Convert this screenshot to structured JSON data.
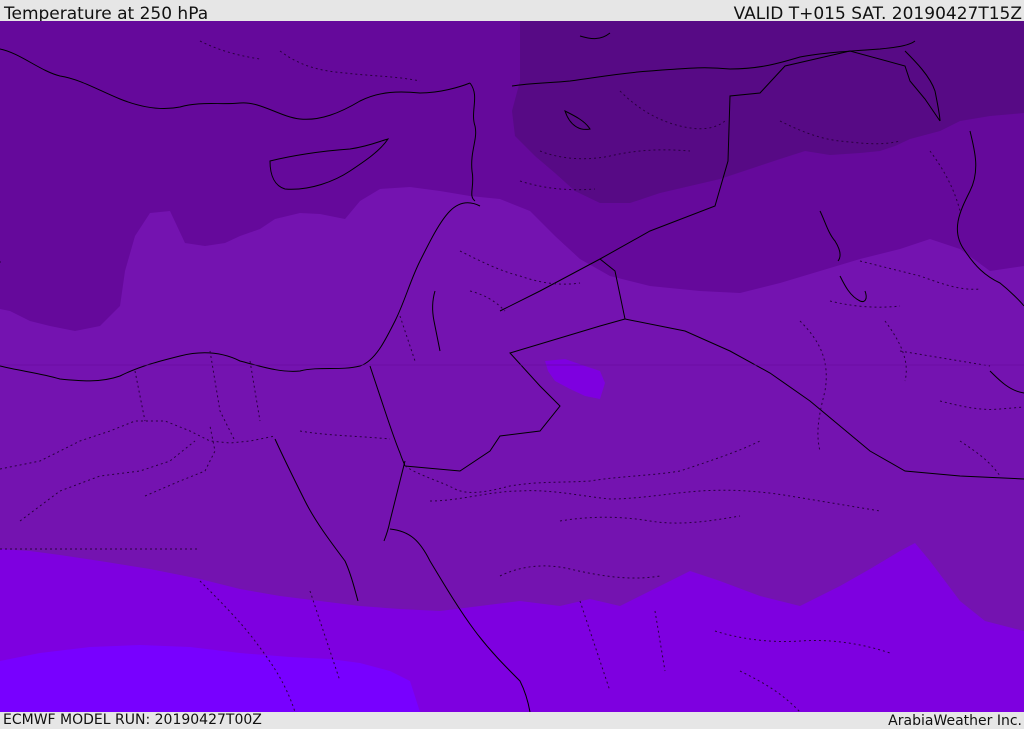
{
  "header": {
    "title": "Temperature at 250 hPa",
    "valid": "VALID T+015 SAT. 20190427T15Z"
  },
  "footer": {
    "model_run": "ECMWF MODEL RUN: 20190427T00Z",
    "credit": "ArabiaWeather Inc."
  },
  "map": {
    "field": "temperature-250hPa",
    "colors": {
      "band_darkest": "#570a85",
      "band_dark": "#65099b",
      "band_mid": "#7413b0",
      "band_light": "#7e00e0",
      "band_lightest": "#7800ff",
      "coastline": "#000000",
      "border": "#2a0040"
    }
  }
}
